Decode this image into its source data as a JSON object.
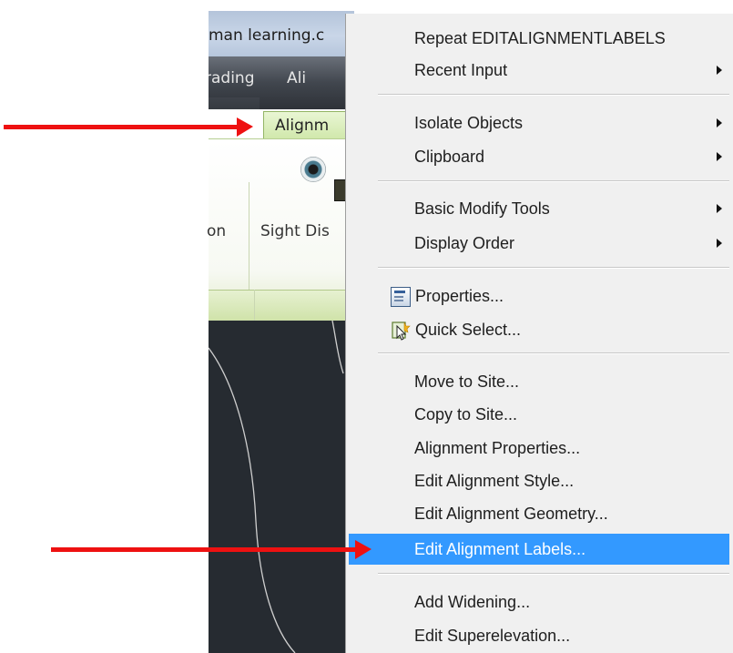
{
  "window": {
    "title_fragment": "man learning.c",
    "tabs": [
      "rading",
      "Ali"
    ],
    "active_tab": "Alignm"
  },
  "ribbon": {
    "labels": [
      "on",
      "Sight Dis"
    ]
  },
  "context_menu": {
    "groups": [
      [
        {
          "label": "Repeat EDITALIGNMENTLABELS",
          "submenu": false
        },
        {
          "label": "Recent Input",
          "submenu": true
        }
      ],
      [
        {
          "label": "Isolate Objects",
          "submenu": true
        },
        {
          "label": "Clipboard",
          "submenu": true
        }
      ],
      [
        {
          "label": "Basic Modify Tools",
          "submenu": true
        },
        {
          "label": "Display Order",
          "submenu": true
        }
      ],
      [
        {
          "label": "Properties...",
          "icon": "properties-icon"
        },
        {
          "label": "Quick Select...",
          "icon": "quick-select-icon"
        }
      ],
      [
        {
          "label": "Move to Site..."
        },
        {
          "label": "Copy to Site..."
        },
        {
          "label": "Alignment Properties..."
        },
        {
          "label": "Edit Alignment Style..."
        },
        {
          "label": "Edit Alignment Geometry..."
        },
        {
          "label": "Edit Alignment Labels...",
          "highlighted": true
        }
      ],
      [
        {
          "label": "Add Widening..."
        },
        {
          "label": "Edit Superelevation..."
        }
      ]
    ]
  },
  "colors": {
    "highlight": "#3399ff",
    "annotation_arrow": "#ee1111",
    "active_tab": "#d8ecb6"
  }
}
